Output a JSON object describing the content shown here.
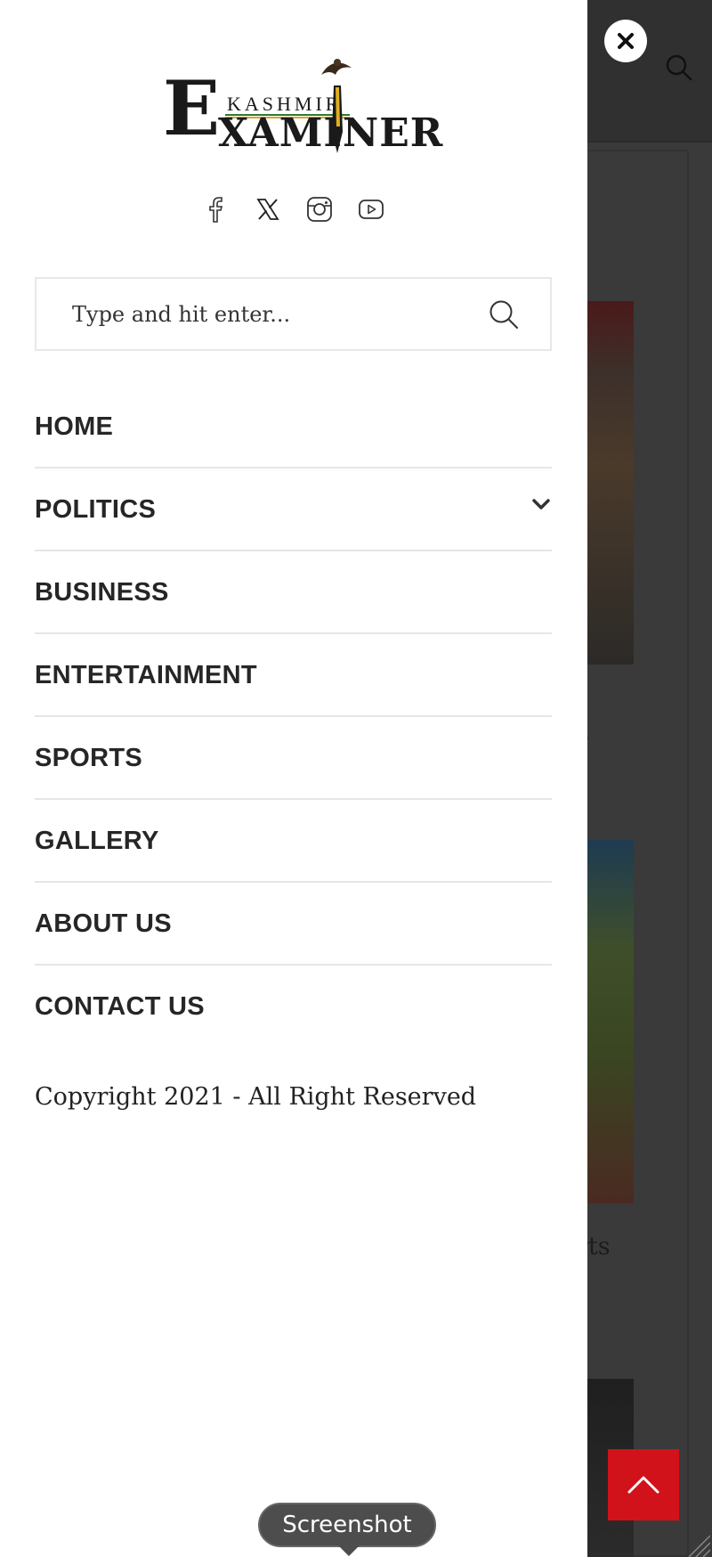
{
  "logo": {
    "small": "KASHMIR",
    "big_letter": "E",
    "rest": "XAMINER"
  },
  "social": [
    {
      "name": "facebook-icon"
    },
    {
      "name": "x-twitter-icon"
    },
    {
      "name": "instagram-icon"
    },
    {
      "name": "youtube-icon"
    }
  ],
  "search": {
    "placeholder": "Type and hit enter..."
  },
  "menu": {
    "items": [
      {
        "label": "HOME"
      },
      {
        "label": "POLITICS",
        "has_submenu": true
      },
      {
        "label": "BUSINESS"
      },
      {
        "label": "ENTERTAINMENT"
      },
      {
        "label": "SPORTS"
      },
      {
        "label": "GALLERY"
      },
      {
        "label": "ABOUT US"
      },
      {
        "label": "CONTACT US"
      }
    ]
  },
  "footer": {
    "copyright": "Copyright 2021 - All Right Reserved"
  },
  "background": {
    "text_fragment": "rts"
  },
  "tooltip": {
    "label": "Screenshot"
  },
  "colors": {
    "accent": "#d2121b",
    "overlay": "#3a3a3a",
    "drawer": "#ffffff",
    "text": "#262626"
  }
}
